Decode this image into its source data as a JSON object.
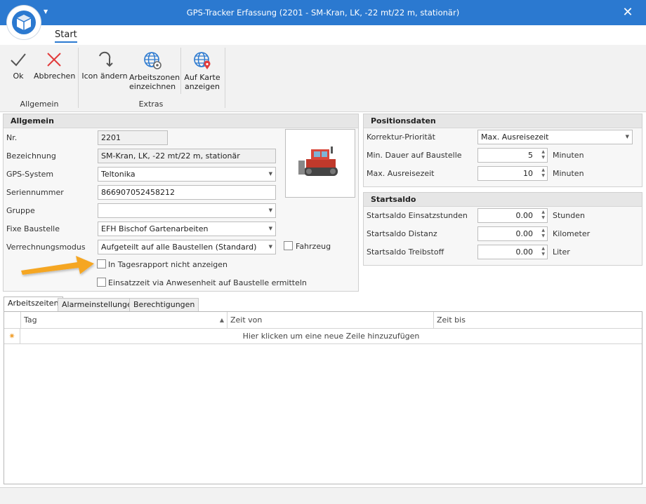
{
  "window": {
    "title": "GPS-Tracker Erfassung (2201 - SM-Kran, LK, -22 mt/22 m, stationär)",
    "accent": "#2b79d0"
  },
  "ribbon": {
    "tab": "Start",
    "buttons": {
      "ok": "Ok",
      "cancel": "Abbrechen",
      "change_icon": "Icon ändern",
      "zones": "Arbeitszonen einzeichnen",
      "map": "Auf Karte anzeigen"
    },
    "groups": {
      "general": "Allgemein",
      "extras": "Extras"
    }
  },
  "general": {
    "header": "Allgemein",
    "labels": {
      "nr": "Nr.",
      "designation": "Bezeichnung",
      "gps_system": "GPS-System",
      "serial": "Seriennummer",
      "group": "Gruppe",
      "site": "Fixe Baustelle",
      "billing": "Verrechnungsmodus"
    },
    "values": {
      "nr": "2201",
      "designation": "SM-Kran, LK, -22 mt/22 m, stationär",
      "gps_system": "Teltonika",
      "serial": "866907052458212",
      "group": "",
      "site": "EFH Bischof Gartenarbeiten",
      "billing": "Aufgeteilt auf alle Baustellen (Standard)"
    },
    "checkboxes": {
      "vehicle": "Fahrzeug",
      "hide_report": "In Tagesrapport nicht anzeigen",
      "attendance": "Einsatzzeit via Anwesenheit auf Baustelle ermitteln"
    }
  },
  "position": {
    "header": "Positionsdaten",
    "labels": {
      "priority": "Korrektur-Priorität",
      "min_duration": "Min. Dauer auf Baustelle",
      "max_travel": "Max. Ausreisezeit"
    },
    "values": {
      "priority": "Max. Ausreisezeit",
      "min_duration": "5",
      "max_travel": "10"
    },
    "units": {
      "min_duration": "Minuten",
      "max_travel": "Minuten"
    }
  },
  "start_balance": {
    "header": "Startsaldo",
    "labels": {
      "hours": "Startsaldo Einsatzstunden",
      "distance": "Startsaldo Distanz",
      "fuel": "Startsaldo Treibstoff"
    },
    "values": {
      "hours": "0.00",
      "distance": "0.00",
      "fuel": "0.00"
    },
    "units": {
      "hours": "Stunden",
      "distance": "Kilometer",
      "fuel": "Liter"
    }
  },
  "tabs": [
    "Arbeitszeiten",
    "Alarmeinstellungen",
    "Berechtigungen"
  ],
  "grid": {
    "columns": [
      "Tag",
      "Zeit von",
      "Zeit bis"
    ],
    "new_row_hint": "Hier klicken um eine neue Zeile hinzuzufügen"
  }
}
